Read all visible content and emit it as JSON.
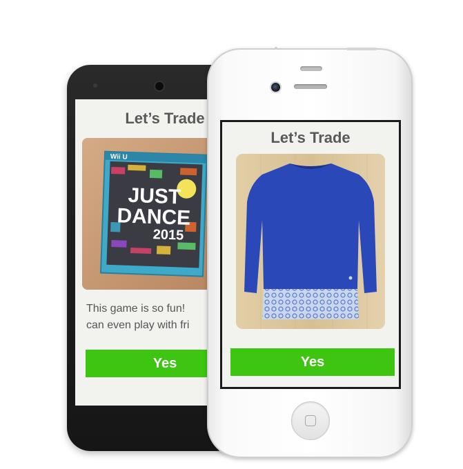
{
  "android_screen": {
    "title": "Let’s Trade",
    "product_image": "just-dance-2015-game-case",
    "cover_text": {
      "platform": "Wii U",
      "game_title_line1": "JUST",
      "game_title_line2": "DANCE",
      "game_year": "2015"
    },
    "description_line1": "This game is so fun!",
    "description_line2": "can even play with fri",
    "yes_label": "Yes",
    "accent_color": "#3ec512"
  },
  "iphone_screen": {
    "title": "Let’s Trade",
    "product_image": "blue-sweater-with-lace-hem",
    "yes_label": "Yes",
    "accent_color": "#3ec512"
  },
  "icons": [
    "home-button-icon",
    "front-camera-icon",
    "earpiece-speaker-icon"
  ]
}
